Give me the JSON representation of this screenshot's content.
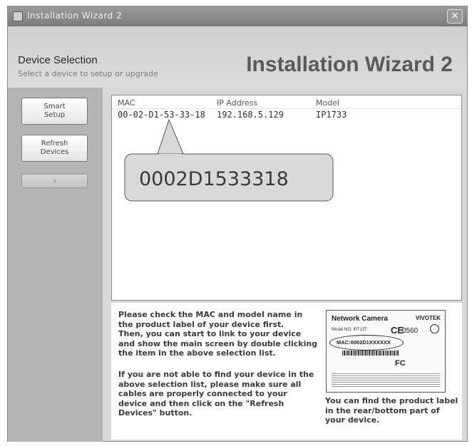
{
  "window": {
    "title": "Installation Wizard 2",
    "close_label": "×"
  },
  "header": {
    "section_title": "Device Selection",
    "section_subtitle": "Select a device to setup or upgrade",
    "wizard_title": "Installation Wizard 2"
  },
  "sidebar": {
    "smart_setup_label": "Smart\nSetup",
    "refresh_label": "Refresh\nDevices",
    "more_label": "»"
  },
  "device_list": {
    "columns": [
      "MAC",
      "IP Address",
      "Model"
    ],
    "rows": [
      {
        "mac": "00-02-D1-53-33-18",
        "ip": "192.168.5.129",
        "model": "IP1733"
      }
    ],
    "callout_text": "0002D1533318"
  },
  "info": {
    "paragraph1": "Please check the MAC and model name in the product label of your device first.\nThen, you can start to link to your device and show the main screen by double clicking the item in the above selection list.",
    "paragraph2": "If you are not able to find your device in the above selection list, please make sure all cables are properly connected to your device and then click on the \"Refresh Devices\" button.",
    "label_caption": "You can find the product label in the rear/bottom part of your device."
  },
  "product_label": {
    "title": "Network Camera",
    "brand": "VIVOTEK",
    "model_line": "Model NO: IP7137",
    "ce_mark": "CE",
    "ce_number": "0560",
    "mac_line": "MAC:0002D1XXXXXX",
    "fc_mark": "FC"
  }
}
